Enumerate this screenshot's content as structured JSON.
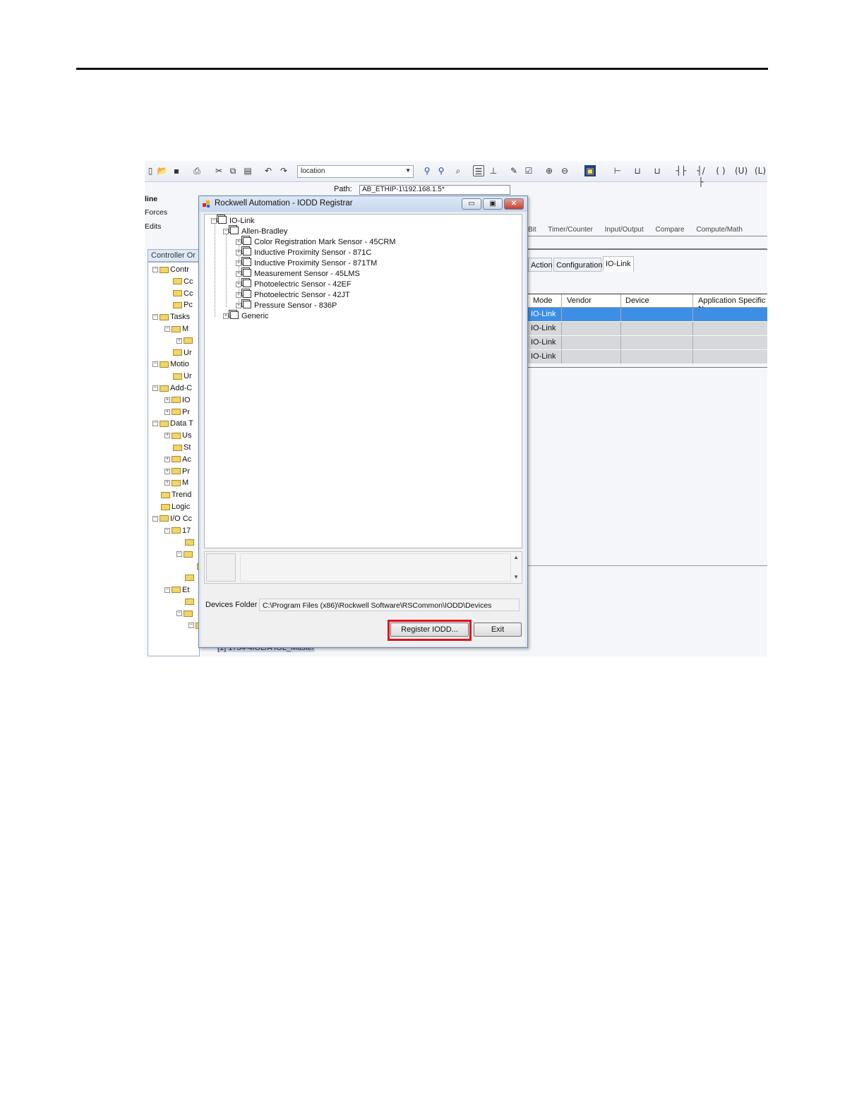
{
  "toolbar": {
    "location_value": "location"
  },
  "left_panel": {
    "items": [
      "line",
      "Forces",
      "Edits"
    ],
    "organizer_tab": "Controller Or",
    "tree": [
      {
        "label": "Contr",
        "depth": 0,
        "expander": "-"
      },
      {
        "label": "Cc",
        "depth": 1,
        "expander": ""
      },
      {
        "label": "Cc",
        "depth": 1,
        "expander": ""
      },
      {
        "label": "Pc",
        "depth": 1,
        "expander": ""
      },
      {
        "label": "Tasks",
        "depth": 0,
        "expander": "-"
      },
      {
        "label": "M",
        "depth": 1,
        "expander": "-"
      },
      {
        "label": "",
        "depth": 2,
        "expander": "+"
      },
      {
        "label": "Ur",
        "depth": 1,
        "expander": ""
      },
      {
        "label": "Motio",
        "depth": 0,
        "expander": "-"
      },
      {
        "label": "Ur",
        "depth": 1,
        "expander": ""
      },
      {
        "label": "Add-C",
        "depth": 0,
        "expander": "-"
      },
      {
        "label": "IO",
        "depth": 1,
        "expander": "+"
      },
      {
        "label": "Pr",
        "depth": 1,
        "expander": "+"
      },
      {
        "label": "Data T",
        "depth": 0,
        "expander": "-"
      },
      {
        "label": "Us",
        "depth": 1,
        "expander": "+"
      },
      {
        "label": "St",
        "depth": 1,
        "expander": ""
      },
      {
        "label": "Ac",
        "depth": 1,
        "expander": "+"
      },
      {
        "label": "Pr",
        "depth": 1,
        "expander": "+"
      },
      {
        "label": "M",
        "depth": 1,
        "expander": "+"
      },
      {
        "label": "Trend",
        "depth": 0,
        "expander": ""
      },
      {
        "label": "Logic",
        "depth": 0,
        "expander": ""
      },
      {
        "label": "I/O Cc",
        "depth": 0,
        "expander": "-"
      },
      {
        "label": "17",
        "depth": 1,
        "expander": "-"
      },
      {
        "label": "",
        "depth": 2,
        "expander": ""
      },
      {
        "label": "",
        "depth": 2,
        "expander": "-"
      },
      {
        "label": "",
        "depth": 3,
        "expander": ""
      },
      {
        "label": "",
        "depth": 2,
        "expander": ""
      },
      {
        "label": "Et",
        "depth": 1,
        "expander": "-"
      },
      {
        "label": "",
        "depth": 2,
        "expander": ""
      },
      {
        "label": "",
        "depth": 2,
        "expander": "-"
      },
      {
        "label": "",
        "depth": 3,
        "expander": "-"
      }
    ],
    "bottom_item": "[1] 1734-4IOL/A IOL_Master"
  },
  "right_pane": {
    "path_label": "Path:",
    "path_value": "AB_ETHIP-1\\192.168.1.5*",
    "ladder_tabs": [
      "Bit",
      "Timer/Counter",
      "Input/Output",
      "Compare",
      "Compute/Math"
    ],
    "prop_tabs": [
      "Action",
      "Configuration",
      "IO-Link"
    ],
    "grid_headers": [
      "Mode",
      "Vendor",
      "Device",
      "Application Specific N"
    ],
    "grid_rows": [
      "IO-Link",
      "IO-Link",
      "IO-Link",
      "IO-Link"
    ]
  },
  "dialog": {
    "title": "Rockwell Automation - IODD Registrar",
    "tree_root": "IO-Link",
    "vendor": "Allen-Bradley",
    "devices": [
      "Color Registration Mark Sensor - 45CRM",
      "Inductive Proximity Sensor - 871C",
      "Inductive Proximity Sensor - 871TM",
      "Measurement Sensor - 45LMS",
      "Photoelectric Sensor - 42EF",
      "Photoelectric Sensor - 42JT",
      "Pressure Sensor - 836P"
    ],
    "generic": "Generic",
    "devices_folder_label": "Devices Folder",
    "devices_folder_value": "C:\\Program Files (x86)\\Rockwell Software\\RSCommon\\IODD\\Devices",
    "register_button": "Register IODD...",
    "exit_button": "Exit"
  },
  "colors": {
    "selection_blue": "#3d8fe6",
    "highlight_red": "#e0141b"
  }
}
